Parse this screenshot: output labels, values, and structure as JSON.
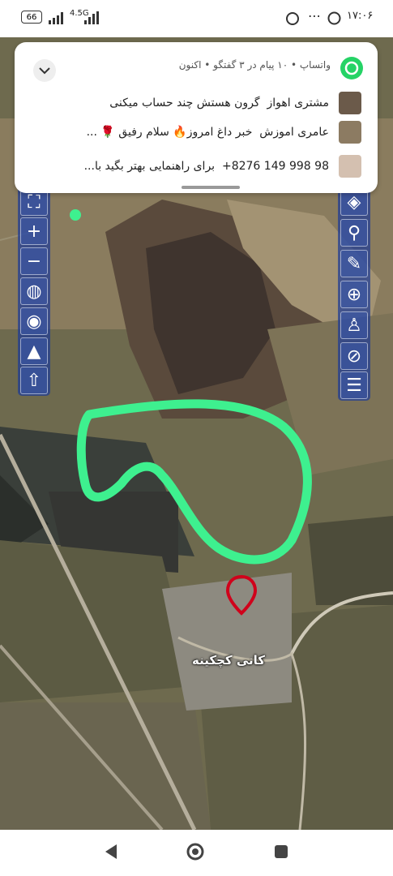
{
  "status_bar": {
    "battery": "66",
    "network": "4.5G",
    "time": "۱۷:۰۶"
  },
  "notification": {
    "app": "واتساپ",
    "summary": "واتساپ • ۱۰ پیام در ۳ گفتگو • اکنون",
    "messages": [
      {
        "sender": "مشتری اهواز",
        "text": "گرون هستش چند حساب میکنی"
      },
      {
        "sender": "عامری اموزش",
        "text": "خبر داغ امروز🔥 سلام رفیق 🌹 ..."
      },
      {
        "sender": "98 998 149 8276+",
        "text": "برای راهنمایی بهتر بگید با..."
      }
    ]
  },
  "map": {
    "place_label": "کانی کچکینه",
    "marker_color": "#d0021b",
    "drawn_outline_color": "#3ef08f"
  },
  "left_tools": [
    {
      "icon": "fullscreen-icon"
    },
    {
      "icon": "zoom-in-icon"
    },
    {
      "icon": "zoom-out-icon"
    },
    {
      "icon": "globe-icon"
    },
    {
      "icon": "globe-stand-icon"
    },
    {
      "icon": "terrain-icon"
    },
    {
      "icon": "arrow-up-icon"
    }
  ],
  "right_tools": [
    {
      "icon": "layers-icon"
    },
    {
      "icon": "search-icon"
    },
    {
      "icon": "pencil-icon"
    },
    {
      "icon": "web-globe-icon"
    },
    {
      "icon": "person-location-icon"
    },
    {
      "icon": "compass-icon"
    },
    {
      "icon": "sliders-icon"
    }
  ]
}
